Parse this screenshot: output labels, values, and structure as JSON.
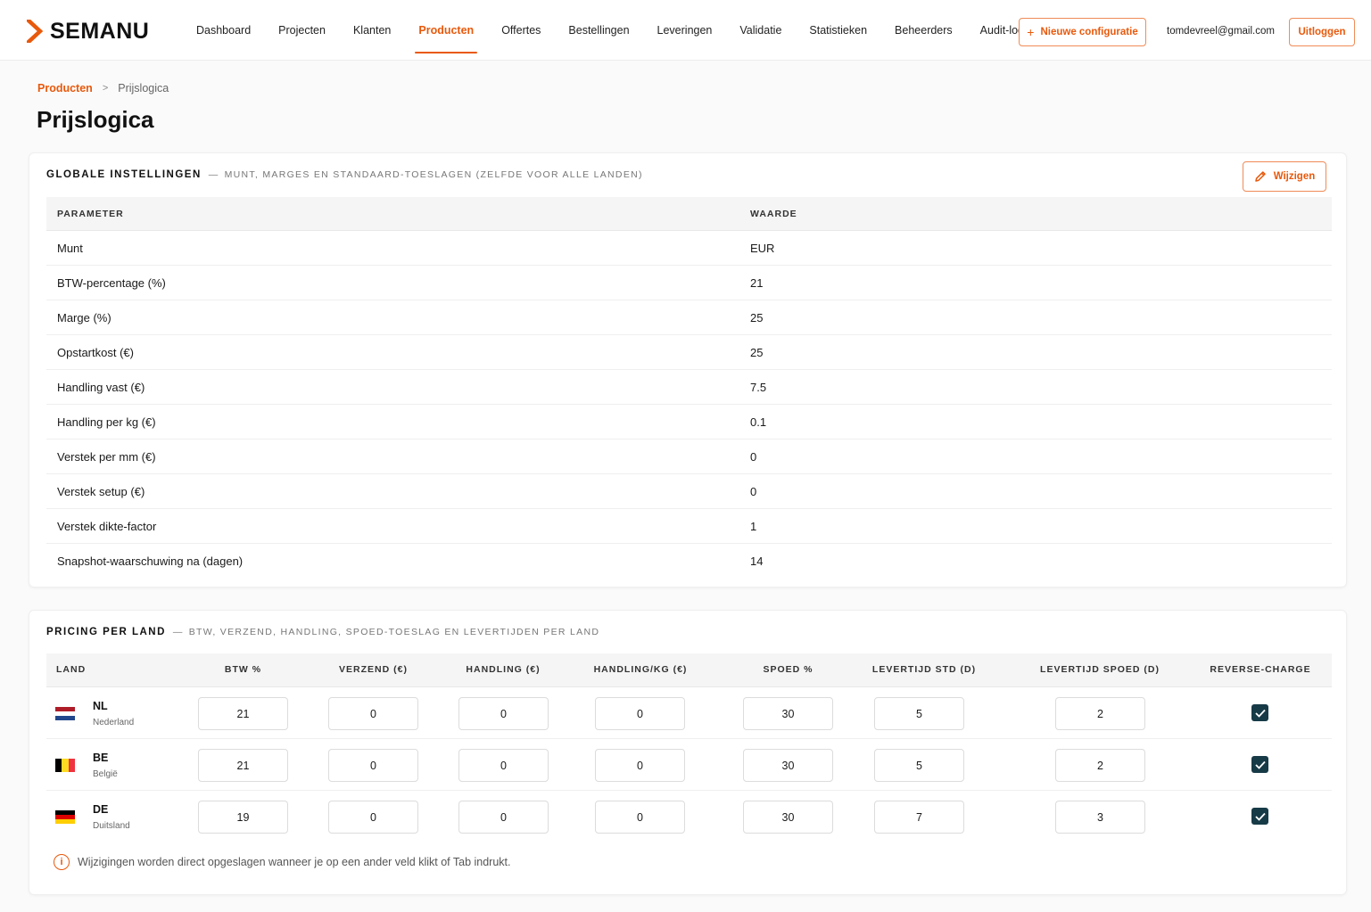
{
  "brand": {
    "name": "SEMANU",
    "accent": "#e8590c"
  },
  "nav": {
    "items": [
      {
        "label": "Dashboard"
      },
      {
        "label": "Projecten"
      },
      {
        "label": "Klanten"
      },
      {
        "label": "Producten"
      },
      {
        "label": "Offertes"
      },
      {
        "label": "Bestellingen"
      },
      {
        "label": "Leveringen"
      },
      {
        "label": "Validatie"
      },
      {
        "label": "Statistieken"
      },
      {
        "label": "Beheerders"
      },
      {
        "label": "Audit-log"
      }
    ],
    "active": "Producten",
    "new_config_label": "Nieuwe configuratie",
    "user_email": "tomdevreel@gmail.com",
    "logout_label": "Uitloggen"
  },
  "breadcrumb": {
    "parent": "Producten",
    "separator": ">",
    "current": "Prijslogica"
  },
  "page": {
    "title": "Prijslogica"
  },
  "global_settings": {
    "title": "GLOBALE INSTELLINGEN",
    "subtitle": "MUNT, MARGES EN STANDAARD-TOESLAGEN (ZELFDE VOOR ALLE LANDEN)",
    "edit_label": "Wijzigen",
    "columns": {
      "parameter": "PARAMETER",
      "value": "WAARDE"
    },
    "rows": [
      {
        "parameter": "Munt",
        "value": "EUR"
      },
      {
        "parameter": "BTW-percentage (%)",
        "value": "21"
      },
      {
        "parameter": "Marge (%)",
        "value": "25"
      },
      {
        "parameter": "Opstartkost (€)",
        "value": "25"
      },
      {
        "parameter": "Handling vast (€)",
        "value": "7.5"
      },
      {
        "parameter": "Handling per kg (€)",
        "value": "0.1"
      },
      {
        "parameter": "Verstek per mm (€)",
        "value": "0"
      },
      {
        "parameter": "Verstek setup (€)",
        "value": "0"
      },
      {
        "parameter": "Verstek dikte-factor",
        "value": "1"
      },
      {
        "parameter": "Snapshot-waarschuwing na (dagen)",
        "value": "14"
      }
    ]
  },
  "country_pricing": {
    "title": "PRICING PER LAND",
    "subtitle": "BTW, VERZEND, HANDLING, SPOED-TOESLAG EN LEVERTIJDEN PER LAND",
    "columns": {
      "land": "LAND",
      "btw": "BTW %",
      "verzend": "VERZEND (€)",
      "handling": "HANDLING (€)",
      "handling_kg": "HANDLING/KG (€)",
      "spoed": "SPOED %",
      "levertijd_std": "LEVERTIJD STD (D)",
      "levertijd_spoed": "LEVERTIJD SPOED (D)",
      "reverse_charge": "REVERSE-CHARGE"
    },
    "rows": [
      {
        "code": "NL",
        "name": "Nederland",
        "flag": [
          "#ae1c28",
          "#ffffff",
          "#21468b"
        ],
        "btw": "21",
        "verzend": "0",
        "handling": "0",
        "handling_kg": "0",
        "spoed": "30",
        "levertijd_std": "5",
        "levertijd_spoed": "2",
        "reverse_charge": true
      },
      {
        "code": "BE",
        "name": "België",
        "flag": [
          "#000000",
          "#fdda24",
          "#ef3340"
        ],
        "btw": "21",
        "verzend": "0",
        "handling": "0",
        "handling_kg": "0",
        "spoed": "30",
        "levertijd_std": "5",
        "levertijd_spoed": "2",
        "reverse_charge": true
      },
      {
        "code": "DE",
        "name": "Duitsland",
        "flag": [
          "#000000",
          "#dd0000",
          "#ffce00"
        ],
        "btw": "19",
        "verzend": "0",
        "handling": "0",
        "handling_kg": "0",
        "spoed": "30",
        "levertijd_std": "7",
        "levertijd_spoed": "3",
        "reverse_charge": true
      }
    ],
    "info_text": "Wijzigingen worden direct opgeslagen wanneer je op een ander veld klikt of Tab indrukt."
  },
  "icons": {
    "logo": "chevron-right-logo-icon",
    "plus": "plus-icon",
    "edit": "pencil-icon",
    "info": "info-circle-icon",
    "check": "checkmark-icon"
  }
}
